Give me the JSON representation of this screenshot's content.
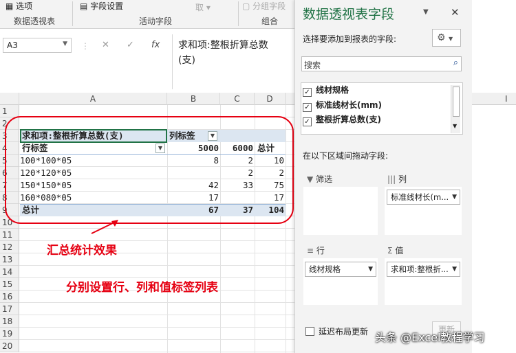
{
  "ribbon": {
    "options_label": "选项",
    "pivot_group": "数据透视表",
    "field_settings": "字段设置",
    "active_field_group": "活动字段",
    "cancel_label": "取",
    "group_field": "分组字段",
    "group_group": "组合"
  },
  "formula_bar": {
    "name_box": "A3",
    "cancel_icon": "✕",
    "confirm_icon": "✓",
    "fx_icon": "fx",
    "content_line1": "求和项:整根折算总数",
    "content_line2": "(支)"
  },
  "grid": {
    "columns": [
      "A",
      "B",
      "C",
      "D",
      "E"
    ],
    "rows": [
      "1",
      "2",
      "3",
      "4",
      "5",
      "6",
      "7",
      "8",
      "9",
      "10",
      "11",
      "12",
      "13",
      "14",
      "15",
      "16",
      "17",
      "18",
      "19",
      "20"
    ],
    "pivot": {
      "value_header": "求和项:整根折算总数(支)",
      "col_labels": "列标签",
      "row_labels": "行标签",
      "col_5000": "5000",
      "col_6000": "6000",
      "total_header": "总计",
      "rows": [
        {
          "label": "100*100*05",
          "b": "8",
          "c": "2",
          "d": "10"
        },
        {
          "label": "120*120*05",
          "b": "",
          "c": "2",
          "d": "2"
        },
        {
          "label": "150*150*05",
          "b": "42",
          "c": "33",
          "d": "75"
        },
        {
          "label": "160*080*05",
          "b": "17",
          "c": "",
          "d": "17"
        }
      ],
      "grand_total": {
        "label": "总计",
        "b": "67",
        "c": "37",
        "d": "104"
      }
    }
  },
  "annotations": {
    "summary_effect": "汇总统计效果",
    "instructions": "分别设置行、列和值标签列表"
  },
  "panel": {
    "title": "数据透视表字段",
    "choose_fields": "选择要添加到报表的字段:",
    "search_placeholder": "搜索",
    "fields": [
      {
        "name": "线材规格",
        "checked": true
      },
      {
        "name": "标准线材长(mm)",
        "checked": true
      },
      {
        "name": "整根折算总数(支)",
        "checked": true
      }
    ],
    "drag_hint": "在以下区域间拖动字段:",
    "filter_label": "筛选",
    "columns_label": "列",
    "rows_label": "行",
    "values_label": "值",
    "columns_field": "标准线材长(m...",
    "rows_field": "线材规格",
    "values_field": "求和项:整根折...",
    "defer_label": "延迟布局更新",
    "update_button": "更新"
  },
  "outside": {
    "col_i": "I"
  },
  "watermark": "头条 @Excel教程学习",
  "colors": {
    "accent": "#217346",
    "annotation": "#e60012",
    "pivot_header": "#dce6f1"
  }
}
